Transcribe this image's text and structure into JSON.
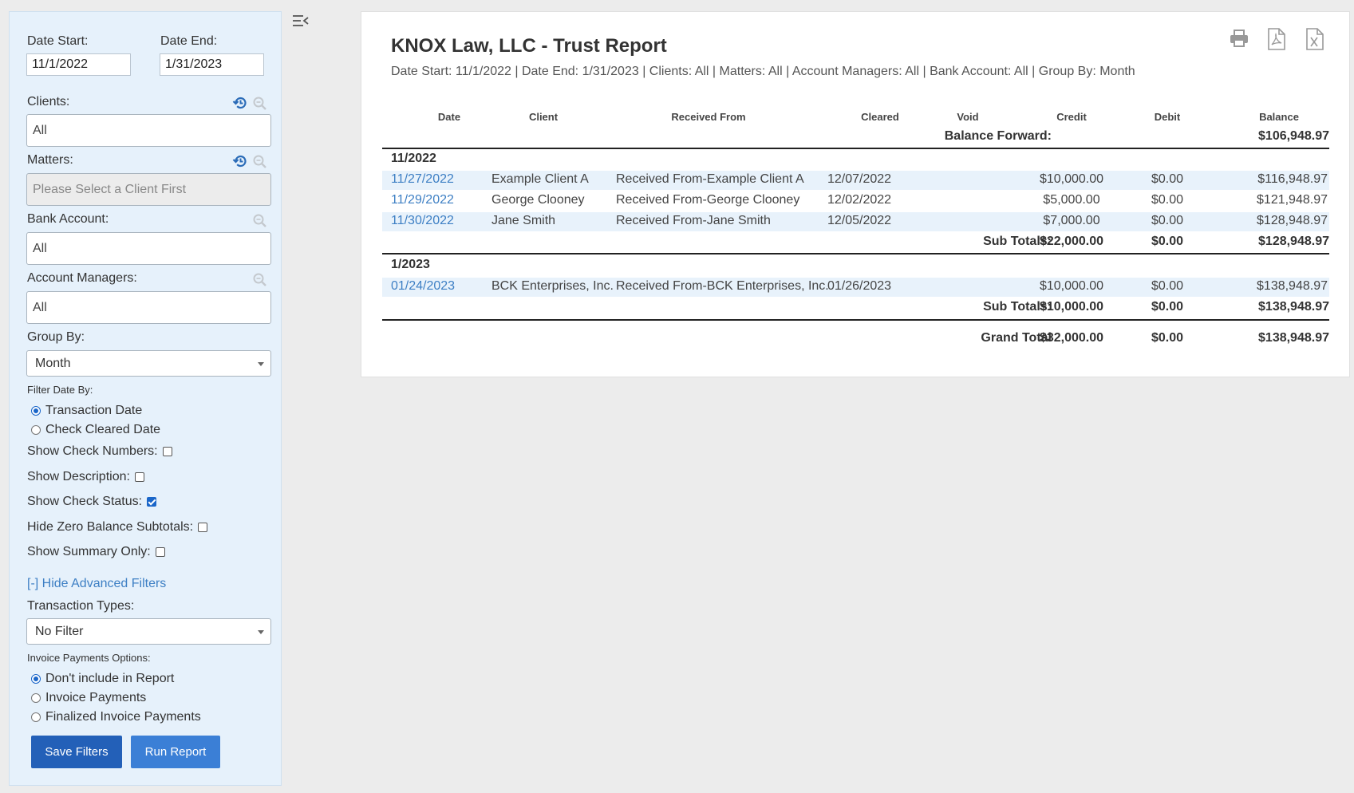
{
  "sidebar": {
    "date_start_label": "Date Start:",
    "date_start_value": "11/1/2022",
    "date_end_label": "Date End:",
    "date_end_value": "1/31/2023",
    "clients_label": "Clients:",
    "clients_value": "All",
    "matters_label": "Matters:",
    "matters_placeholder": "Please Select a Client First",
    "bank_account_label": "Bank Account:",
    "bank_account_value": "All",
    "account_managers_label": "Account Managers:",
    "account_managers_value": "All",
    "group_by_label": "Group By:",
    "group_by_value": "Month",
    "filter_date_by_label": "Filter Date By:",
    "filter_date_options": [
      "Transaction Date",
      "Check Cleared Date"
    ],
    "show_check_numbers_label": "Show Check Numbers:",
    "show_description_label": "Show Description:",
    "show_check_status_label": "Show Check Status:",
    "hide_zero_balance_label": "Hide Zero Balance Subtotals:",
    "show_summary_only_label": "Show Summary Only:",
    "advanced_filters_link": "[-] Hide Advanced Filters",
    "transaction_types_label": "Transaction Types:",
    "transaction_types_value": "No Filter",
    "invoice_payments_label": "Invoice Payments Options:",
    "invoice_payment_options": [
      "Don't include in Report",
      "Invoice Payments",
      "Finalized Invoice Payments"
    ],
    "save_filters_button": "Save Filters",
    "run_report_button": "Run Report"
  },
  "report": {
    "title": "KNOX Law, LLC - Trust Report",
    "subtitle": "Date Start: 11/1/2022 | Date End: 1/31/2023 | Clients: All | Matters: All | Account Managers: All | Bank Account: All | Group By: Month",
    "columns": [
      "Date",
      "Client",
      "Received From",
      "Cleared",
      "Void",
      "Credit",
      "Debit",
      "Balance"
    ],
    "balance_forward_label": "Balance Forward:",
    "balance_forward_value": "$106,948.97",
    "groups": [
      {
        "label": "11/2022",
        "rows": [
          {
            "date": "11/27/2022",
            "client": "Example Client A",
            "received_from": "Received From-Example Client A",
            "cleared": "12/07/2022",
            "void": "",
            "credit": "$10,000.00",
            "debit": "$0.00",
            "balance": "$116,948.97"
          },
          {
            "date": "11/29/2022",
            "client": "George Clooney",
            "received_from": "Received From-George Clooney",
            "cleared": "12/02/2022",
            "void": "",
            "credit": "$5,000.00",
            "debit": "$0.00",
            "balance": "$121,948.97"
          },
          {
            "date": "11/30/2022",
            "client": "Jane Smith",
            "received_from": "Received From-Jane Smith",
            "cleared": "12/05/2022",
            "void": "",
            "credit": "$7,000.00",
            "debit": "$0.00",
            "balance": "$128,948.97"
          }
        ],
        "subtotal_label": "Sub Totals:",
        "subtotal_credit": "$22,000.00",
        "subtotal_debit": "$0.00",
        "subtotal_balance": "$128,948.97"
      },
      {
        "label": "1/2023",
        "rows": [
          {
            "date": "01/24/2023",
            "client": "BCK Enterprises, Inc.",
            "received_from": "Received From-BCK Enterprises, Inc.",
            "cleared": "01/26/2023",
            "void": "",
            "credit": "$10,000.00",
            "debit": "$0.00",
            "balance": "$138,948.97"
          }
        ],
        "subtotal_label": "Sub Totals:",
        "subtotal_credit": "$10,000.00",
        "subtotal_debit": "$0.00",
        "subtotal_balance": "$138,948.97"
      }
    ],
    "grand_total_label": "Grand Total",
    "grand_total_credit": "$32,000.00",
    "grand_total_debit": "$0.00",
    "grand_total_balance": "$138,948.97"
  },
  "icons": {
    "reset": "history-icon",
    "search": "magnifier-icon",
    "collapse": "collapse-sidebar-icon",
    "print": "printer-icon",
    "pdf": "pdf-icon",
    "excel": "excel-icon"
  },
  "colors": {
    "sidebar_bg": "#e6f1fb",
    "link": "#3d7fc4",
    "primary_button": "#2360b8",
    "secondary_button": "#3b7fd6",
    "row_highlight": "#e8f2fb"
  }
}
